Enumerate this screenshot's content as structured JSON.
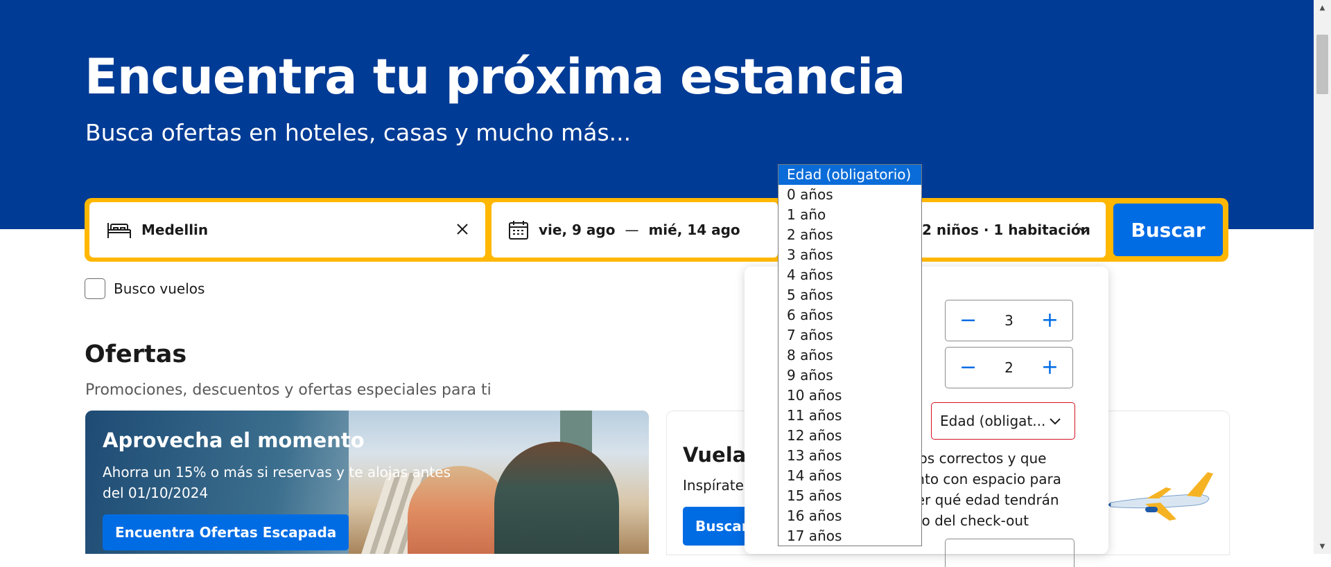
{
  "hero": {
    "title": "Encuentra tu próxima estancia",
    "subtitle": "Busca ofertas en hoteles, casas y mucho más..."
  },
  "search": {
    "destination": "Medellin",
    "checkin": "vie, 9 ago",
    "separator": "—",
    "checkout": "mié, 14 ago",
    "occupancy": "2 niños · 1 habitación",
    "button": "Buscar"
  },
  "flights_checkbox": {
    "label": "Busco vuelos",
    "checked": false
  },
  "offers": {
    "title": "Ofertas",
    "subtitle": "Promociones, descuentos y ofertas especiales para ti"
  },
  "promo": {
    "title": "Aprovecha el momento",
    "text": "Ahorra un 15% o más si reservas y te alojas antes del 01/10/2024",
    "button": "Encuentra Ofertas Escapada"
  },
  "card2": {
    "title": "Vuela",
    "text": "Inspírate,",
    "button": "Buscar v"
  },
  "occupancy_panel": {
    "adults": "3",
    "children": "2",
    "age_select": "Edad (obligat...",
    "note": "cios correctos y que ento con espacio para ber qué edad tendrán nto del check-out"
  },
  "age_dropdown": {
    "selected_index": 0,
    "options": [
      "Edad (obligatorio)",
      "0 años",
      "1 año",
      "2 años",
      "3 años",
      "4 años",
      "5 años",
      "6 años",
      "7 años",
      "8 años",
      "9 años",
      "10 años",
      "11 años",
      "12 años",
      "13 años",
      "14 años",
      "15 años",
      "16 años",
      "17 años"
    ]
  },
  "colors": {
    "brand_blue": "#003b95",
    "accent_yellow": "#ffb700",
    "button_blue": "#006ce4",
    "error_red": "#d4111e"
  }
}
